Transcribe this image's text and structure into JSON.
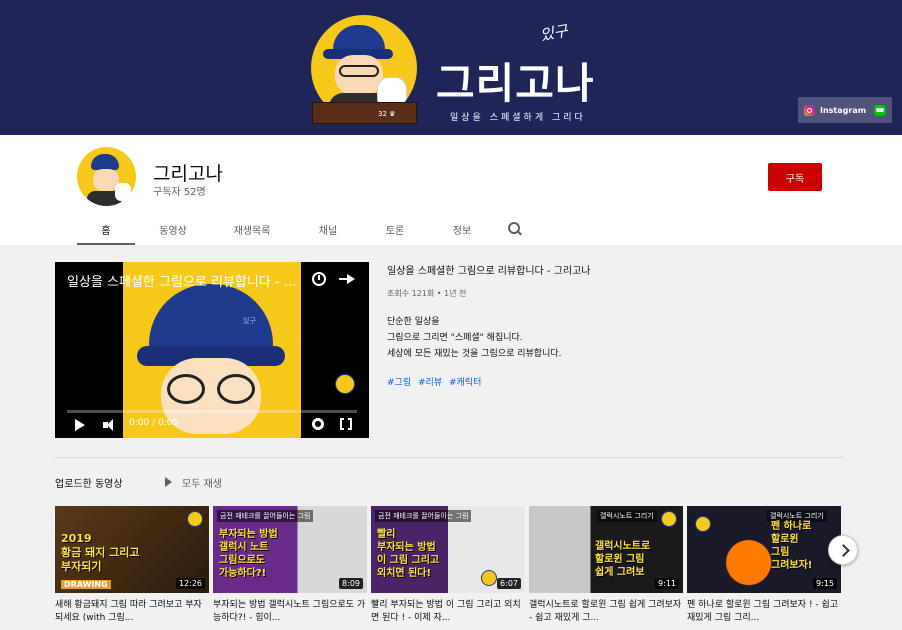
{
  "banner": {
    "title": "그리고나",
    "signature": "있구",
    "tagline": "일상을 스페셜하게 그리다",
    "desk_label": "32 ♛",
    "link_instagram": "Instagram",
    "bg_color": "#1f2559"
  },
  "channel": {
    "name": "그리고나",
    "subscribers": "구독자 52명",
    "subscribe_label": "구독",
    "subscribe_color": "#cc0000"
  },
  "tabs": [
    {
      "label": "홈",
      "active": true
    },
    {
      "label": "동영상",
      "active": false
    },
    {
      "label": "재생목록",
      "active": false
    },
    {
      "label": "채널",
      "active": false
    },
    {
      "label": "토론",
      "active": false
    },
    {
      "label": "정보",
      "active": false
    }
  ],
  "featured": {
    "player_title": "일상을 스페셜한 그림으로 리뷰합니다 - 그리고나",
    "hat_logo": "있구",
    "time": "0:00 / 0:05",
    "progress": 0,
    "title": "일상을 스페셜한 그림으로 리뷰합니다 - 그리고나",
    "meta": "조회수 121회 • 1년 전",
    "description": [
      "단순한 일상을",
      "그림으로 그리면 \"스페셜\" 해집니다.",
      "세상에 모든 재밌는 것을 그림으로 리뷰합니다."
    ],
    "hashtags": [
      "#그림",
      "#리뷰",
      "#캐릭터"
    ]
  },
  "uploads": {
    "section_title": "업로드한 동영상",
    "play_all": "모두 재생",
    "videos": [
      {
        "thumb_badge": "",
        "thumb_text": "2019\n황금 돼지 그리고\n부자되기",
        "thumb_sub": "DRAWING",
        "duration": "12:26",
        "title": "새해 황금돼지 그림 따라 그려보고 부자 되세요 (with 그림...",
        "bg": "#3a2a1a"
      },
      {
        "thumb_badge": "금전 재테크를 끌어들이는 그림",
        "thumb_text": "부자되는 방법\n갤럭시 노트\n그림으로도\n가능하다?!",
        "thumb_sub": "",
        "duration": "8:09",
        "title": "부자되는 방법 갤럭시노트 그림으로도 가능하다?! - 힘이...",
        "bg": "#5a2a7a"
      },
      {
        "thumb_badge": "금전 재테크를 끌어들이는 그림",
        "thumb_text": "빨리\n부자되는 방법\n이 그림 그리고\n외치면 된다!",
        "thumb_sub": "",
        "duration": "6:07",
        "title": "빨리 부자되는 방법 이 그림 그리고 외치면 된다 ! - 이제 자...",
        "bg": "#4a2466"
      },
      {
        "thumb_badge": "갤럭시노트 그리기",
        "thumb_text": "갤럭시노트로\n할로윈 그림\n쉽게 그려보",
        "thumb_sub": "",
        "duration": "9:11",
        "title": "갤럭시노트로 할로윈 그림 쉽게 그려보자 - 쉽고 재밌게 그...",
        "bg": "#2a1a2a"
      },
      {
        "thumb_badge": "갤럭시노트 그리기",
        "thumb_text": "펜 하나로\n할로윈\n그림\n그려보자!",
        "thumb_sub": "",
        "duration": "9:15",
        "title": "펜 하나로 할로윈 그림 그려보자 ! - 쉽고 재밌게 그림 그리...",
        "bg": "#1a1a2a"
      }
    ]
  },
  "icons": [
    "search-icon",
    "play-icon",
    "volume-icon",
    "settings-icon",
    "fullscreen-icon",
    "clock-icon",
    "share-icon",
    "chevron-right-icon",
    "instagram-icon",
    "line-icon"
  ]
}
